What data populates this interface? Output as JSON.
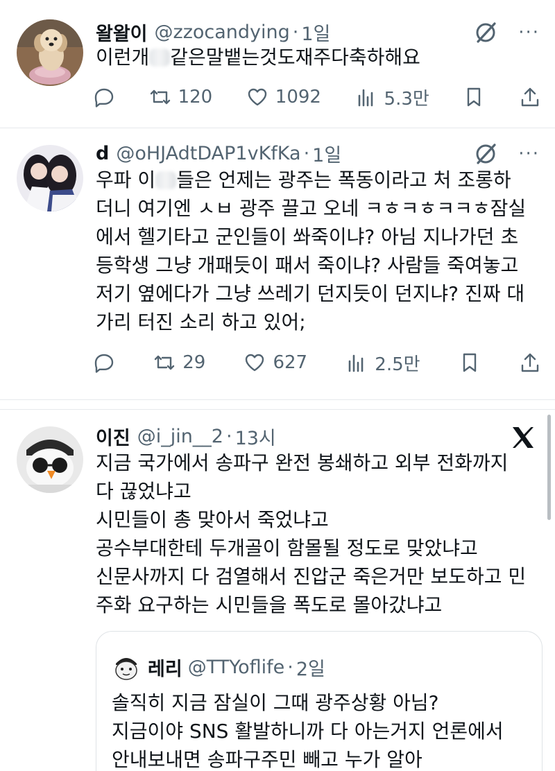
{
  "tweets": [
    {
      "name": "왈왈이",
      "handle": "@zzocandying",
      "dot": "·",
      "time": "1일",
      "lines": [
        "이런개",
        "같은말뱉는것도재주다축하해요"
      ],
      "replies_icon": "reply-icon",
      "retweets": "120",
      "likes": "1092",
      "views": "5.3만"
    },
    {
      "name": "d",
      "handle": "@oHJAdtDAP1vKfKa",
      "dot": "·",
      "time": "1일",
      "line1_pre": "우파 이",
      "line1_post": "들은 언제는 광주는 폭동이라고 처 조롱하",
      "lines": [
        "더니 여기엔 ㅅㅂ 광주 끌고 오네 ㅋㅎㅋㅎㅋㅋㅎ잠실",
        "에서 헬기타고 군인들이 쏴죽이냐? 아님 지나가던 초",
        "등학생 그냥 개패듯이 패서 죽이냐? 사람들 죽여놓고",
        "저기 옆에다가 그냥 쓰레기 던지듯이 던지냐? 진짜 대",
        "가리 터진 소리 하고 있어;"
      ],
      "retweets": "29",
      "likes": "627",
      "views": "2.5만"
    },
    {
      "name": "이진",
      "handle": "@i_jin__2",
      "dot": "·",
      "time": "13시",
      "lines": [
        "지금 국가에서 송파구 완전 봉쇄하고 외부 전화까지",
        "다 끊었냐고",
        "시민들이 총 맞아서 죽었냐고",
        "공수부대한테 두개골이 함몰될 정도로 맞았냐고",
        "신문사까지 다 검열해서 진압군 죽은거만 보도하고 민",
        "주화 요구하는 시민들을 폭도로 몰아갔냐고"
      ],
      "quote": {
        "name": "레리",
        "handle": "@TTYoflife",
        "dot": "·",
        "time": "2일",
        "lines": [
          "솔직히 지금 잠실이 그때 광주상황 아님?",
          "지금이야 SNS 활발하니까 다 아는거지 언론에서",
          "안내보내면 송파구주민 빼고 누가 알아"
        ]
      }
    }
  ],
  "more_label": "···",
  "colors": {
    "text": "#0f1419",
    "secondary": "#536471",
    "border": "#e6e9ec"
  }
}
